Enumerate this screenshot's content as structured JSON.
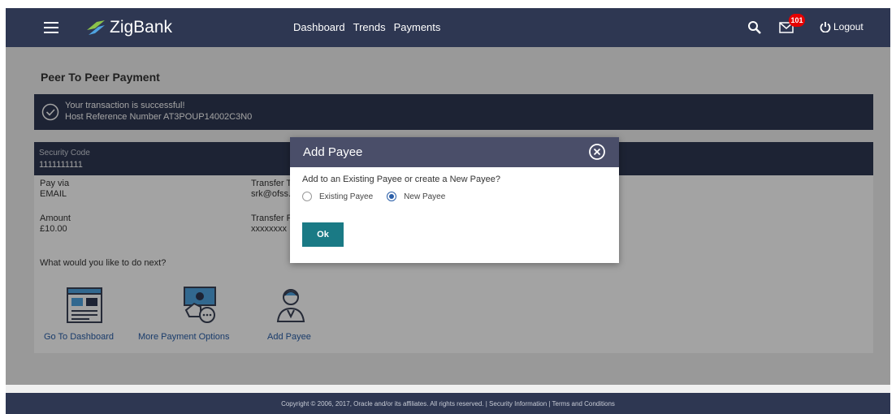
{
  "header": {
    "brand": "ZigBank",
    "nav": [
      "Dashboard",
      "Trends",
      "Payments"
    ],
    "notification_count": "101",
    "logout_label": "Logout"
  },
  "page": {
    "title": "Peer To Peer Payment"
  },
  "success": {
    "message": "Your transaction is successful!",
    "reference": "Host Reference Number AT3POUP14002C3N0"
  },
  "details": {
    "security_code_label": "Security Code",
    "security_code_value": "1111111111",
    "pay_via_label": "Pay via",
    "pay_via_value": "EMAIL",
    "transfer_to_label": "Transfer T",
    "transfer_to_value": "srk@ofss.",
    "amount_label": "Amount",
    "amount_value": "£10.00",
    "transfer_from_label": "Transfer F",
    "transfer_from_value": "xxxxxxxx"
  },
  "next_steps": {
    "question": "What would you like to do next?",
    "actions": [
      "Go To Dashboard",
      "More Payment Options",
      "Add Payee"
    ]
  },
  "footer": {
    "text": "Copyright © 2006, 2017, Oracle and/or its affiliates. All rights reserved. | Security Information | Terms and Conditions"
  },
  "modal": {
    "title": "Add Payee",
    "question": "Add to an Existing Payee or create a New Payee?",
    "options": [
      "Existing Payee",
      "New Payee"
    ],
    "selected": "New Payee",
    "ok_label": "Ok"
  },
  "colors": {
    "header_bg": "#2e3752",
    "modal_header_bg": "#4a4e69",
    "ok_button": "#1a7a85",
    "link": "#2a5ea8",
    "badge": "#e60000"
  }
}
